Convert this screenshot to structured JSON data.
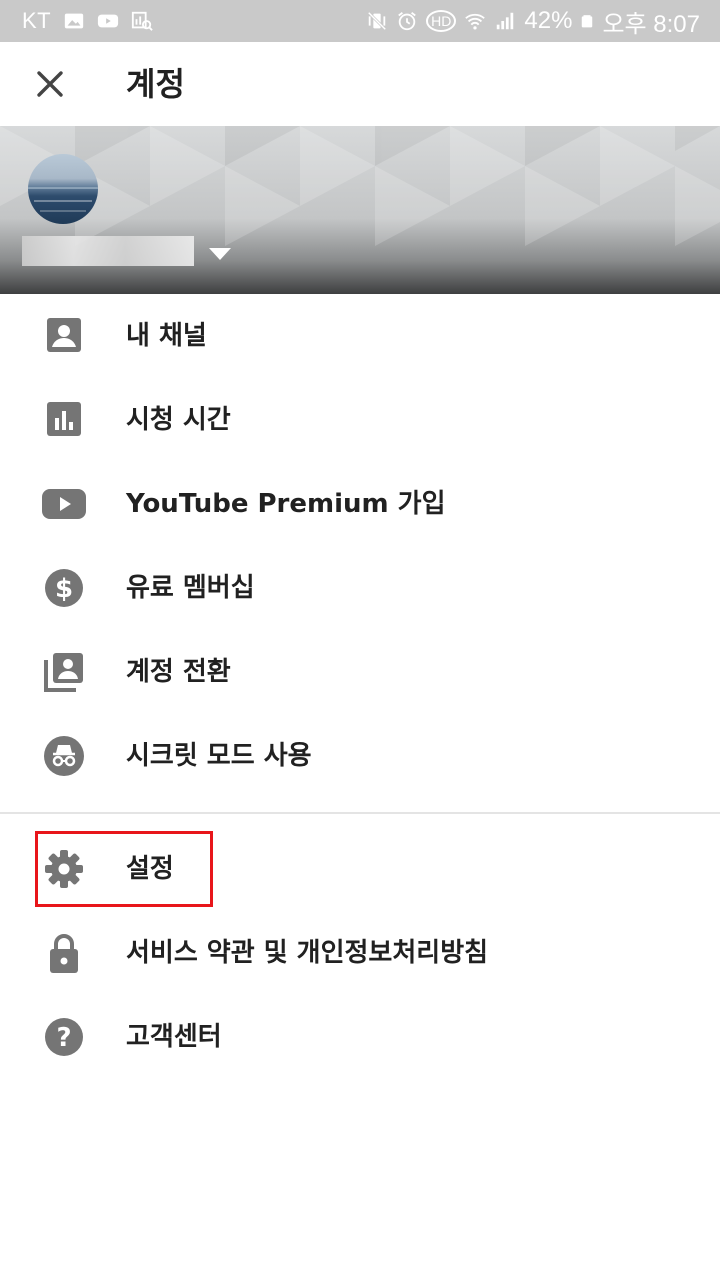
{
  "status_bar": {
    "carrier": "KT",
    "battery": "42%",
    "time": "오후 8:07",
    "hd_badge": "HD"
  },
  "app_bar": {
    "title": "계정",
    "close_icon": "close-icon"
  },
  "menu": {
    "primary": [
      {
        "label": "내 채널",
        "icon": "account-box-icon"
      },
      {
        "label": "시청 시간",
        "icon": "bar-chart-icon"
      },
      {
        "label": "YouTube Premium 가입",
        "icon": "youtube-play-icon"
      },
      {
        "label": "유료 멤버십",
        "icon": "dollar-circle-icon"
      },
      {
        "label": "계정 전환",
        "icon": "switch-account-icon"
      },
      {
        "label": "시크릿 모드 사용",
        "icon": "incognito-icon"
      }
    ],
    "secondary": [
      {
        "label": "설정",
        "icon": "gear-icon"
      },
      {
        "label": "서비스 약관 및 개인정보처리방침",
        "icon": "lock-icon"
      },
      {
        "label": "고객센터",
        "icon": "help-icon"
      }
    ]
  },
  "colors": {
    "icon_gray": "#757575",
    "text": "#212121",
    "highlight_red": "#e8151a",
    "status_bar_bg": "#c9c9c9"
  }
}
